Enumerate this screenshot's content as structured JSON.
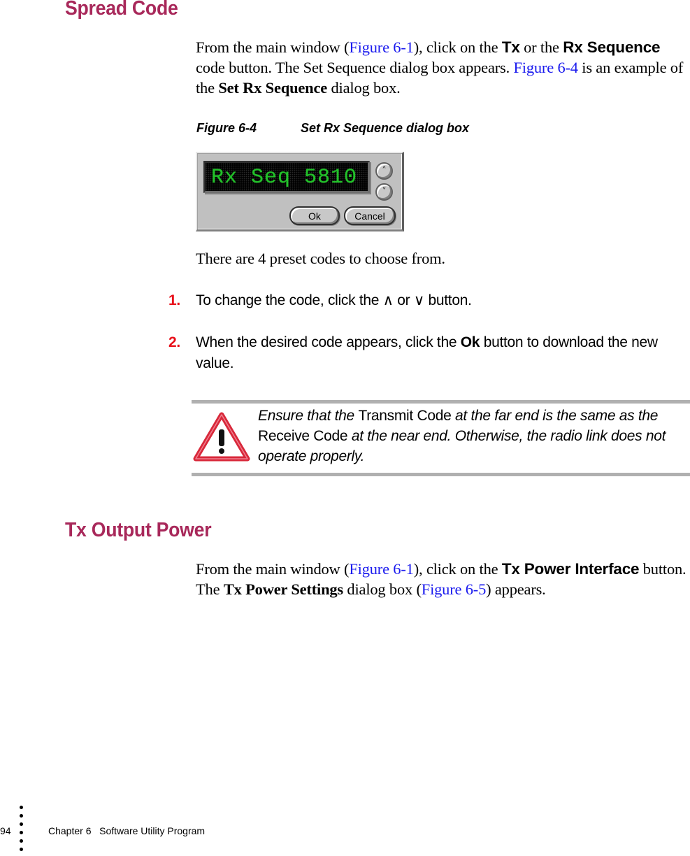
{
  "section1": {
    "heading": "Spread Code",
    "para": {
      "t1": "From the main window (",
      "link1": "Figure 6-1",
      "t2": "), click on the ",
      "b1": "Tx",
      "t3": " or the ",
      "b2": "Rx Sequence",
      "t4": " code button. The Set Sequence dialog box appears. ",
      "link2": "Figure 6-4",
      "t5": " is an example of the ",
      "b3": "Set Rx Sequence",
      "t6": " dialog box."
    },
    "figure": {
      "number": "Figure 6-4",
      "title": "Set Rx Sequence dialog box",
      "dialog": {
        "display_text": "Rx Seq 5810",
        "up_icon": "˄",
        "down_icon": "˅",
        "ok_label": "Ok",
        "cancel_label": "Cancel"
      }
    },
    "preset_text": "There are 4 preset codes to choose from.",
    "steps": [
      {
        "num": "1.",
        "t1": "To change the code, click the ∧ or ∨ button."
      },
      {
        "num": "2.",
        "t1": "When the desired code appears, click the ",
        "b1": "Ok",
        "t2": " button to download the new value."
      }
    ],
    "note": {
      "icon": "warning-triangle-icon",
      "i1": "Ensure that the ",
      "r1": "Transmit Code",
      "i2": " at the far end is the same as the ",
      "r2": "Receive Code",
      "i3": " at the near end. Otherwise, the radio link does not operate properly."
    }
  },
  "section2": {
    "heading": "Tx Output Power",
    "para": {
      "t1": "From the main window (",
      "link1": "Figure 6-1",
      "t2": "), click on the ",
      "b1": "Tx Power Interface",
      "t3": " button. The ",
      "b2": "Tx Power Settings",
      "t4": " dialog box (",
      "link2": "Figure 6-5",
      "t5": ") appears."
    }
  },
  "footer": {
    "page_number": "94",
    "chapter": "Chapter 6   Software Utility Program"
  },
  "colors": {
    "heading": "#a8285a",
    "link": "#1a1aee",
    "step_number": "#e8101a",
    "display_text": "#22c22a"
  }
}
